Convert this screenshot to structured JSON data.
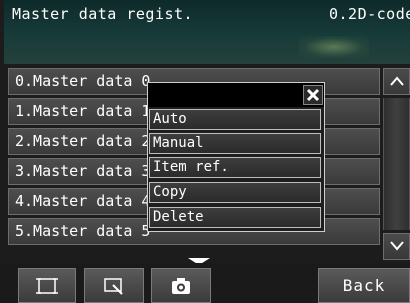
{
  "header": {
    "title": "Master data regist.",
    "mode": "0.2D-code"
  },
  "list": {
    "items": [
      {
        "label": "0.Master data 0"
      },
      {
        "label": "1.Master data 1"
      },
      {
        "label": "2.Master data 2"
      },
      {
        "label": "3.Master data 3"
      },
      {
        "label": "4.Master data 4"
      },
      {
        "label": "5.Master data 5"
      }
    ]
  },
  "popup": {
    "title": "",
    "items": [
      {
        "label": "Auto"
      },
      {
        "label": "Manual"
      },
      {
        "label": "Item ref."
      },
      {
        "label": "Copy"
      },
      {
        "label": "Delete"
      }
    ]
  },
  "footer": {
    "tools": [
      {
        "icon": "fit-screen-icon"
      },
      {
        "icon": "zoom-region-icon"
      },
      {
        "icon": "camera-icon"
      }
    ],
    "back_label": "Back"
  },
  "colors": {
    "background": "#1c1c1c",
    "row": "#444444",
    "popup_border": "#cfcfcf",
    "text": "#ffffff"
  }
}
